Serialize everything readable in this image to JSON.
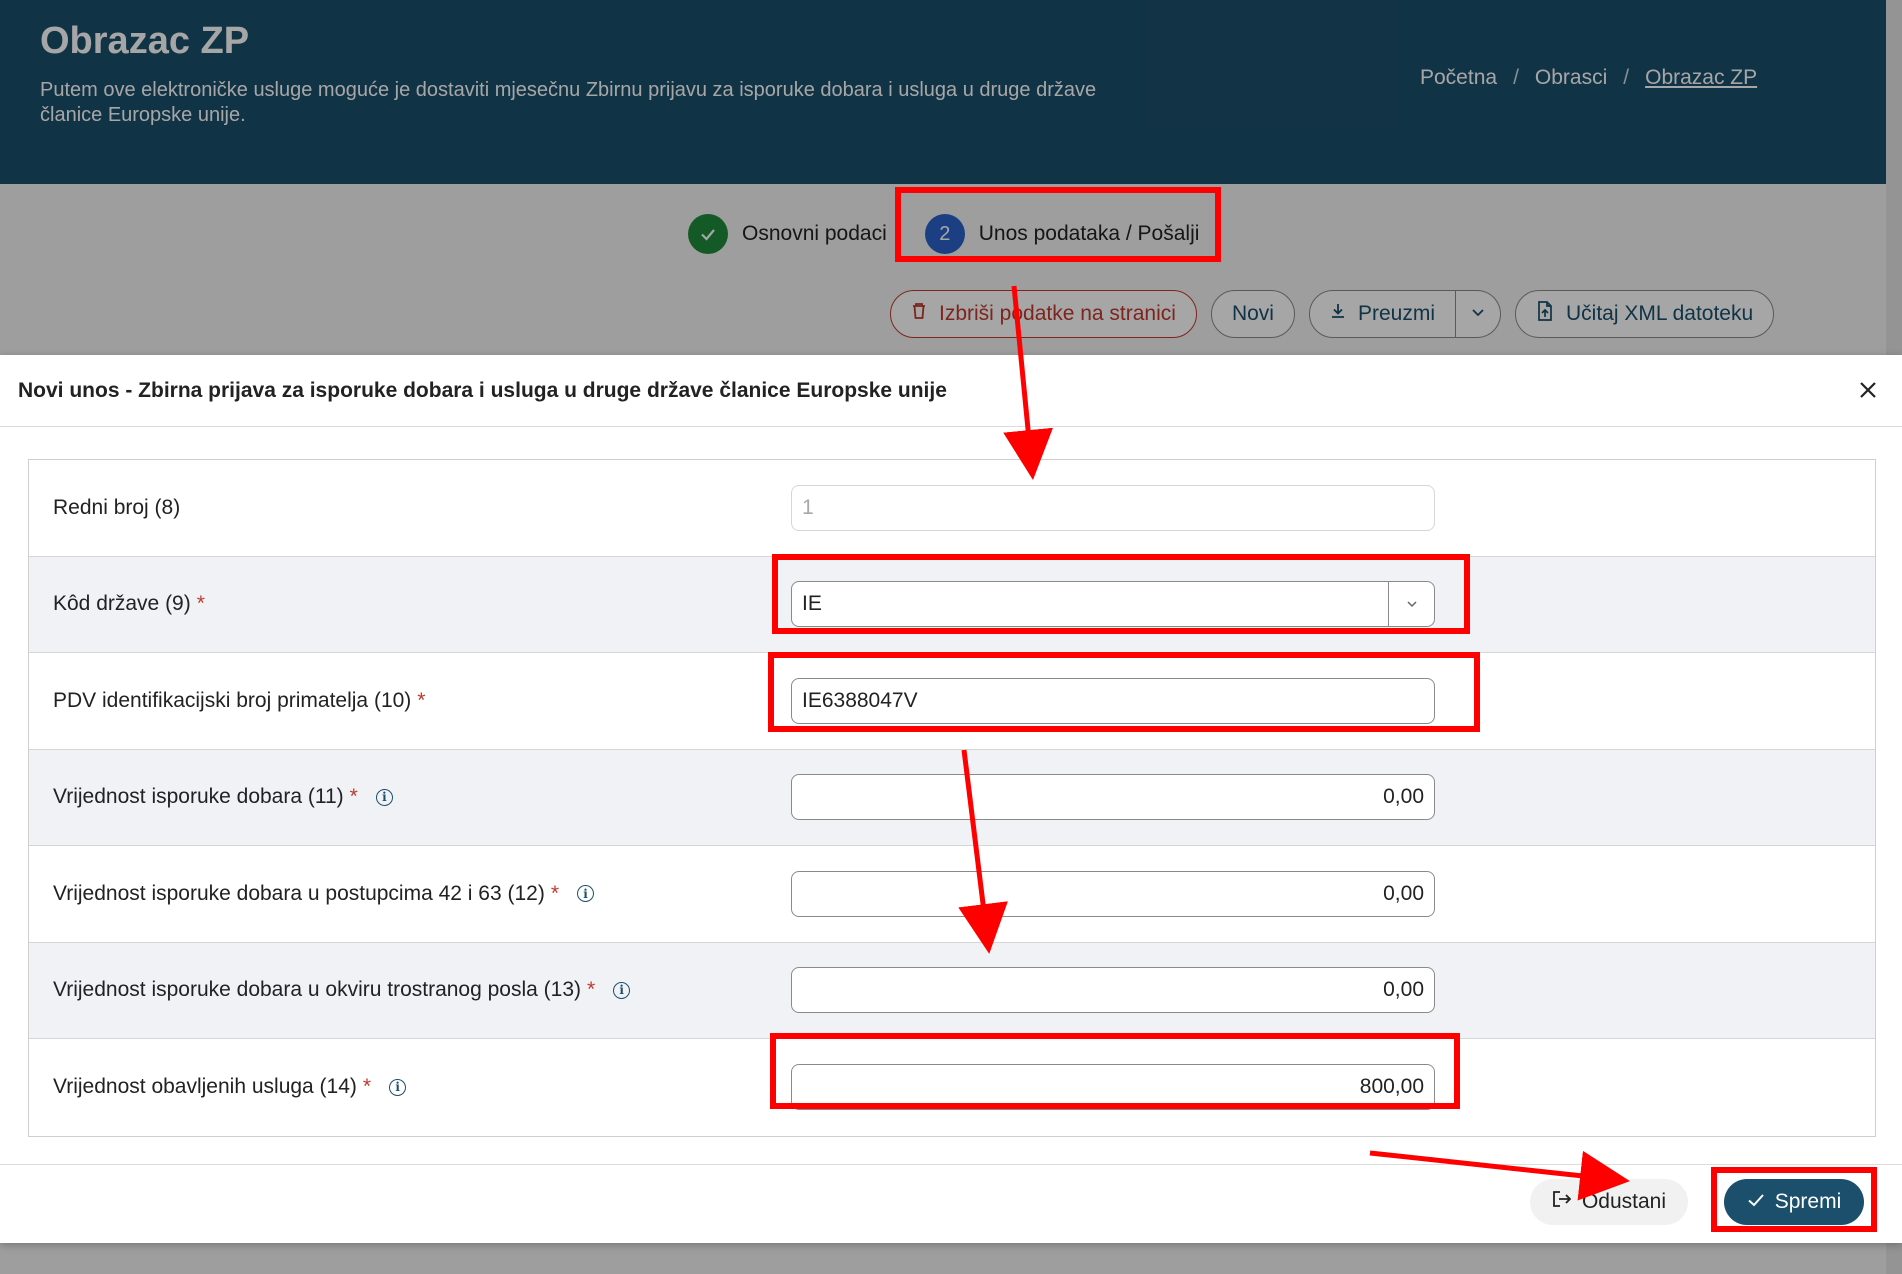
{
  "header": {
    "title": "Obrazac ZP",
    "description": "Putem ove elektroničke usluge moguće je dostaviti mjesečnu Zbirnu prijavu za isporuke dobara i usluga u druge države članice Europske unije."
  },
  "breadcrumb": {
    "items": [
      "Početna",
      "Obrasci",
      "Obrazac ZP"
    ],
    "separator": "/"
  },
  "stepper": {
    "steps": [
      {
        "label": "Osnovni podaci",
        "status": "done",
        "icon": "check-icon"
      },
      {
        "label": "Unos podataka / Pošalji",
        "status": "active",
        "number": "2"
      }
    ]
  },
  "toolbar": {
    "delete_label": "Izbriši podatke na stranici",
    "new_label": "Novi",
    "download_label": "Preuzmi",
    "upload_label": "Učitaj XML datoteku"
  },
  "modal": {
    "title": "Novi unos - Zbirna prijava za isporuke dobara i usluga u druge države članice Europske unije",
    "fields": [
      {
        "label": "Redni broj (8)",
        "value": "1",
        "required": false,
        "info": false
      },
      {
        "label": "Kôd države (9)",
        "value": "IE",
        "required": true,
        "info": false
      },
      {
        "label": "PDV identifikacijski broj primatelja (10)",
        "value": "IE6388047V",
        "required": true,
        "info": false
      },
      {
        "label": "Vrijednost isporuke dobara (11)",
        "value": "0,00",
        "required": true,
        "info": true
      },
      {
        "label": "Vrijednost isporuke dobara u postupcima 42 i 63 (12)",
        "value": "0,00",
        "required": true,
        "info": true
      },
      {
        "label": "Vrijednost isporuke dobara u okviru trostranog posla (13)",
        "value": "0,00",
        "required": true,
        "info": true
      },
      {
        "label": "Vrijednost obavljenih usluga (14)",
        "value": "800,00",
        "required": true,
        "info": true
      }
    ],
    "cancel_label": "Odustani",
    "save_label": "Spremi"
  },
  "colors": {
    "header_bg": "#1b4f6c",
    "annotation": "#ff0000",
    "required": "#c0392b",
    "step_done": "#1f8a3b",
    "step_active": "#2b62c9"
  }
}
